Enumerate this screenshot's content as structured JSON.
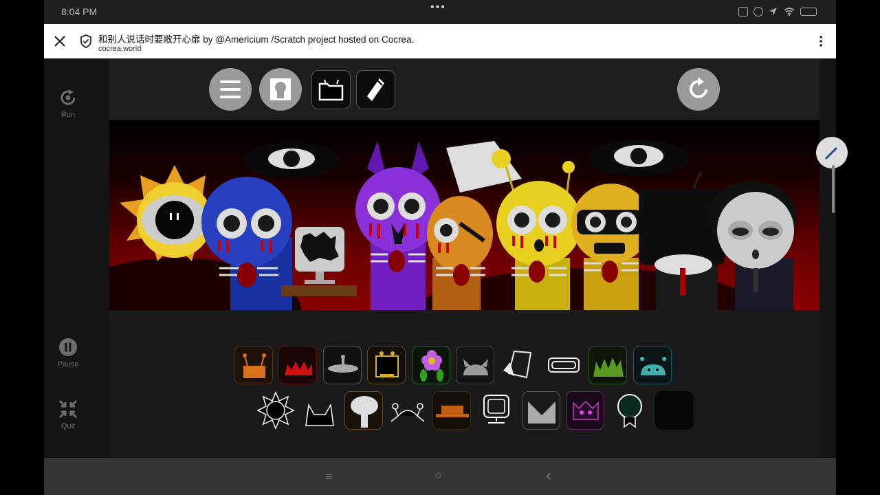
{
  "status": {
    "time": "8:04 PM",
    "dots": "•••"
  },
  "browser": {
    "title": "和别人说话时要敞开心扉 by @Americium /Scratch project hosted on Cocrea.",
    "url": "cocrea.world"
  },
  "left_rail": {
    "run_label": "Run",
    "pause_label": "Pause",
    "quit_label": "Quit"
  },
  "toolbar": {
    "icons": [
      "menu-icon",
      "portrait-icon",
      "folder-icon",
      "pen-icon",
      "reset-icon"
    ]
  },
  "palette": {
    "row1": [
      "orange-antenna",
      "red-spikes",
      "grey-saucer",
      "black-yellow-box",
      "green-flower",
      "grey-horns",
      "paper-cup",
      "goggles",
      "green-grass",
      "teal-antenna"
    ],
    "row2": [
      "sun-outline",
      "cat-ears",
      "mushroom-cap",
      "crab",
      "orange-hat",
      "monitor",
      "grey-envelope",
      "purple-crown",
      "medal",
      "empty"
    ]
  },
  "colors": {
    "accent_red": "#8a0000",
    "button_grey": "#9a9a9a"
  },
  "nav": {
    "menu": "≡",
    "home": "○",
    "back": "‹"
  }
}
